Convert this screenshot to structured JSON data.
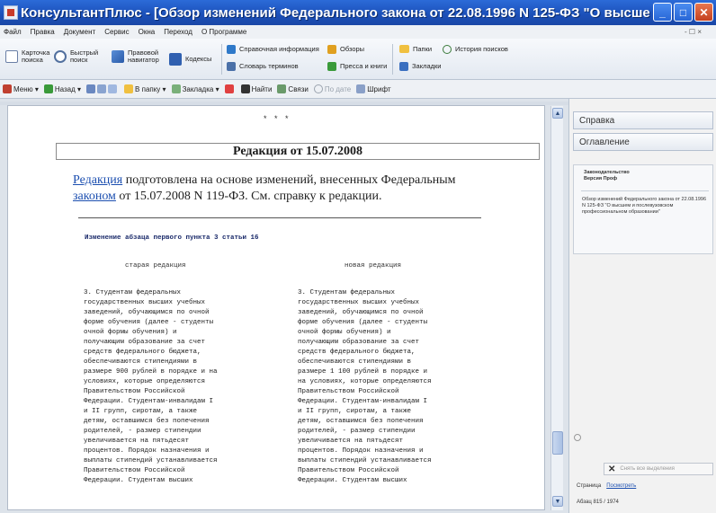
{
  "window": {
    "title": "КонсультантПлюс - [Обзор изменений Федерального закона от 22.08.1996 N 125-ФЗ \"О высше...",
    "buttons": {
      "minimize": "_",
      "maximize": "□",
      "close": "✕"
    }
  },
  "menubar": {
    "items": [
      "Файл",
      "Правка",
      "Документ",
      "Сервис",
      "Окна",
      "Переход",
      "О Программе"
    ],
    "right": "- ☐ ×"
  },
  "bigbar": {
    "card_search": "Карточка поиска",
    "quick_search": "Быстрый поиск",
    "legal_navigator": "Правовой навигатор",
    "codexes": "Кодексы",
    "reference_info": "Справочная информация",
    "reviews": "Обзоры",
    "folders": "Папки",
    "search_history": "История поисков",
    "dictionary": "Словарь терминов",
    "press": "Пресса и книги",
    "bookmarks": "Закладки"
  },
  "toolbar2": {
    "menu": "Меню",
    "back": "Назад",
    "to_folder": "В папку",
    "bookmark": "Закладка",
    "find": "Найти",
    "links": "Связи",
    "edition": "По дате",
    "font": "Шрифт"
  },
  "document": {
    "stars": "* * *",
    "edition_title": "Редакция от 15.07.2008",
    "intro_link1": "Редакция",
    "intro_text1": " подготовлена на основе изменений, внесенных Федеральным",
    "intro_link2": "законом",
    "intro_text2": " от 15.07.2008 N 119-ФЗ. См. справку к редакции.",
    "change_header": "Изменение абзаца первого пункта 3 статьи 16",
    "old_header": "старая редакция",
    "new_header": "новая редакция",
    "old_lines": [
      "3.   Студентам    федеральных",
      "государственных  высших  учебных",
      "заведений,   обучающимся  по  очной",
      "форме  обучения  (далее  -  студенты",
      "очной    формы    обучения)    и",
      "получающим  образование  за  счет",
      "средств   федерального   бюджета,",
      "обеспечиваются   стипендиями   в",
      "размере 900 рублей в порядке и на",
      "условиях,    которые   определяются",
      "Правительством          Российской",
      "Федерации.  Студентам-инвалидам  I",
      "и  II  групп,  сиротам,  а  также",
      "детям,  оставшимся  без  попечения",
      "родителей,  -  размер   стипендии",
      "увеличивается     на     пятьдесят",
      "процентов.  Порядок  назначения  и",
      "выплаты  стипендий  устанавливается",
      "Правительством          Российской",
      "Федерации.    Студентам    высших"
    ],
    "new_lines": [
      "3.   Студентам    федеральных",
      "государственных  высших  учебных",
      "заведений,   обучающимся  по  очной",
      "форме  обучения  (далее  -  студенты",
      "очной    формы    обучения)    и",
      "получающим  образование  за  счет",
      "средств   федерального   бюджета,",
      "обеспечиваются   стипендиями   в",
      "размере  1 100 рублей  в  порядке  и",
      "на  условиях,  которые  определяются",
      "Правительством          Российской",
      "Федерации.  Студентам-инвалидам  I",
      "и  II  групп,  сиротам,  а  также",
      "детям,  оставшимся  без  попечения",
      "родителей,  -  размер   стипендии",
      "увеличивается     на     пятьдесят",
      "процентов.  Порядок  назначения  и",
      "выплаты  стипендий  устанавливается",
      "Правительством          Российской",
      "Федерации.    Студентам    высших"
    ]
  },
  "rightpanel": {
    "tab_help": "Справка",
    "tab_contents": "Оглавление",
    "box_header": "Законодательство\nВерсия Проф",
    "box_text": "Обзор изменений Федерального закона от 22.08.1996 N 125-ФЗ \"О высшем и послевузовском профессиональном образовании\"",
    "clear_button": "Снять все выделения",
    "page_label": "Страница",
    "page_link": "Посмотреть",
    "para_label": "Абзац",
    "para_value": "815 / 1974"
  },
  "colors": {
    "titlebar": "#1b4fb8",
    "link": "#1c4fb0",
    "panel_bg": "#f2f2f2"
  }
}
